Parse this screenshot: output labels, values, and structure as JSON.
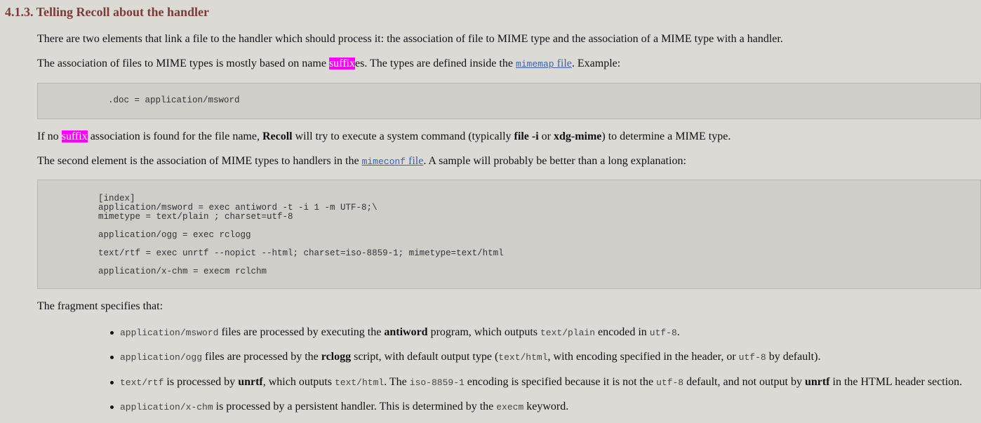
{
  "section_heading": "4.1.3. Telling Recoll about the handler",
  "p1": "There are two elements that link a file to the handler which should process it: the association of file to MIME type and the association of a MIME type with a handler.",
  "p2": {
    "t1": "The association of files to MIME types is mostly based on name ",
    "hl": "suffix",
    "t2": "es. The types are defined inside the ",
    "link_code": "mimemap",
    "link_text": " file",
    "t3": ". Example:"
  },
  "code1": "    .doc = application/msword",
  "p3": {
    "t1": "If no ",
    "hl": "suffix",
    "t2": " association is found for the file name, ",
    "b1": "Recoll",
    "t3": " will try to execute a system command (typically ",
    "b2": "file -i",
    "t4": " or ",
    "b3": "xdg-mime",
    "t5": ") to determine a MIME type."
  },
  "p4": {
    "t1": "The second element is the association of MIME types to handlers in the ",
    "link_code": "mimeconf",
    "link_text": " file",
    "t2": ". A sample will probably be better than a long explanation:"
  },
  "code2": "[index]\napplication/msword = exec antiword -t -i 1 -m UTF-8;\\\nmimetype = text/plain ; charset=utf-8\n\napplication/ogg = exec rclogg\n\ntext/rtf = exec unrtf --nopict --html; charset=iso-8859-1; mimetype=text/html\n\napplication/x-chm = execm rclchm",
  "p5": "The fragment specifies that:",
  "bullets": {
    "b1": {
      "c1": "application/msword",
      "t1": " files are processed by executing the ",
      "b": "antiword",
      "t2": " program, which outputs ",
      "c2": "text/plain",
      "t3": " encoded in ",
      "c3": "utf-8",
      "t4": "."
    },
    "b2": {
      "c1": "application/ogg",
      "t1": " files are processed by the ",
      "b": "rclogg",
      "t2": " script, with default output type (",
      "c2": "text/html",
      "t3": ", with encoding specified in the header, or ",
      "c3": "utf-8",
      "t4": " by default)."
    },
    "b3": {
      "c1": "text/rtf",
      "t1": " is processed by ",
      "b": "unrtf",
      "t2": ", which outputs ",
      "c2": "text/html",
      "t3": ". The ",
      "c3": "iso-8859-1",
      "t4": " encoding is specified because it is not the ",
      "c4": "utf-8",
      "t5": " default, and not output by ",
      "b2": "unrtf",
      "t6": " in the HTML header section."
    },
    "b4": {
      "c1": "application/x-chm",
      "t1": " is processed by a persistent handler. This is determined by the ",
      "c2": "execm",
      "t2": " keyword."
    }
  }
}
